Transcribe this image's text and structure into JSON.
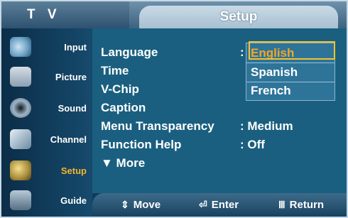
{
  "header": {
    "tv_label": "T V",
    "title": "Setup"
  },
  "sidebar": {
    "items": [
      {
        "label": "Input",
        "icon": "input-icon",
        "active": false
      },
      {
        "label": "Picture",
        "icon": "picture-icon",
        "active": false
      },
      {
        "label": "Sound",
        "icon": "sound-icon",
        "active": false
      },
      {
        "label": "Channel",
        "icon": "channel-icon",
        "active": false
      },
      {
        "label": "Setup",
        "icon": "setup-icon",
        "active": true
      },
      {
        "label": "Guide",
        "icon": "guide-icon",
        "active": false
      }
    ]
  },
  "menu": {
    "items": [
      {
        "label": "Language",
        "value": ":"
      },
      {
        "label": "Time",
        "value": ""
      },
      {
        "label": "V-Chip",
        "value": ""
      },
      {
        "label": "Caption",
        "value": ""
      },
      {
        "label": "Menu Transparency",
        "value": ": Medium"
      },
      {
        "label": "Function Help",
        "value": ": Off"
      },
      {
        "label": "▼ More",
        "value": ""
      }
    ]
  },
  "dropdown": {
    "options": [
      "English",
      "Spanish",
      "French"
    ],
    "selected": "English"
  },
  "footer": {
    "move": "Move",
    "enter": "Enter",
    "return": "Return"
  },
  "colors": {
    "accent": "#f6c229",
    "selected_text": "#f5a623",
    "panel": "#1a5f80"
  }
}
